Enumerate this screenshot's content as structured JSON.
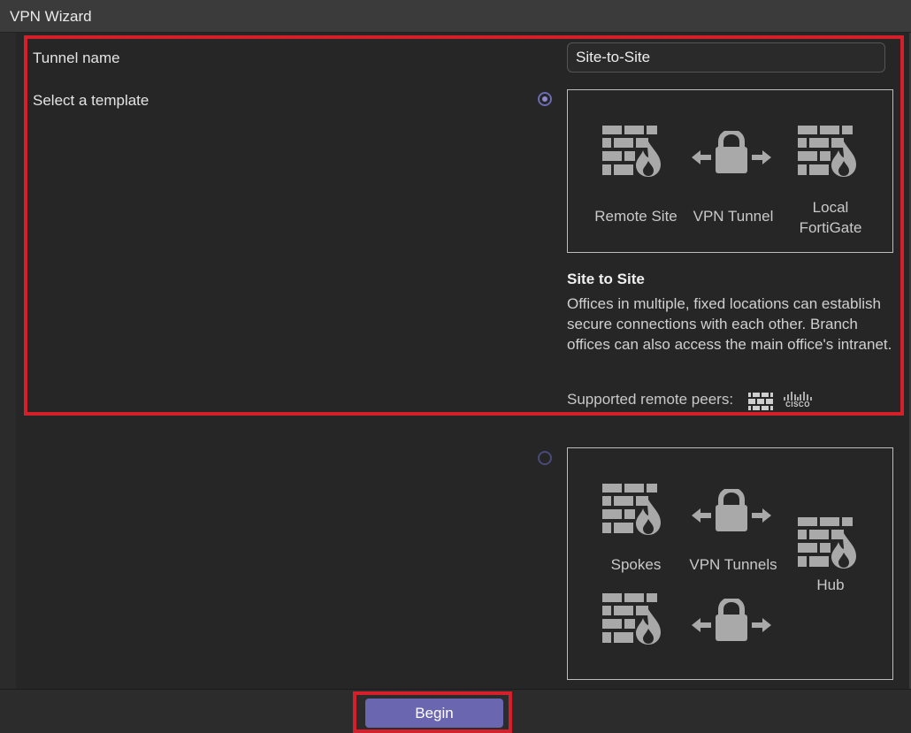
{
  "window": {
    "title": "VPN Wizard"
  },
  "form": {
    "tunnel_name_label": "Tunnel name",
    "tunnel_name_value": "Site-to-Site",
    "template_label": "Select a template"
  },
  "templates": [
    {
      "selected": true,
      "captions": {
        "left": "Remote Site",
        "middle": "VPN Tunnel",
        "right": "Local FortiGate"
      },
      "title": "Site to Site",
      "description": "Offices in multiple, fixed locations can establish secure connections with each other. Branch offices can also access the main office's intranet.",
      "supported_peers_label": "Supported remote peers:",
      "peer_icons": [
        "fortinet-icon",
        "cisco-icon"
      ],
      "peer_cisco_text": "CISCO"
    },
    {
      "selected": false,
      "captions": {
        "left": "Spokes",
        "middle": "VPN Tunnels",
        "right": "Hub"
      }
    }
  ],
  "footer": {
    "begin_label": "Begin"
  },
  "colors": {
    "accent": "#6a66b0",
    "highlight": "#d4202a",
    "icon": "#a9a9a9"
  }
}
